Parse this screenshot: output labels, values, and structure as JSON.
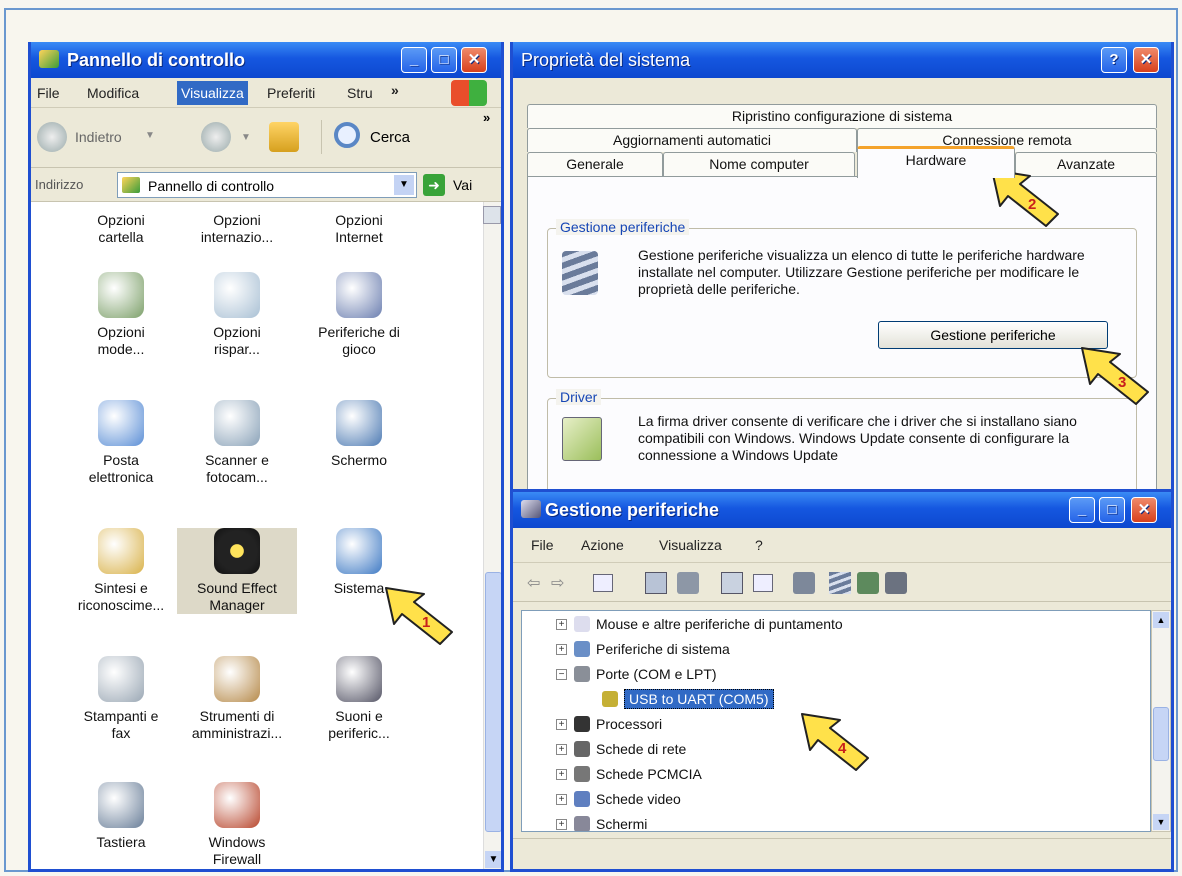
{
  "colors": {
    "title_blue": "#1557e0",
    "close_red": "#d8401c",
    "xp_beige": "#ece9d8",
    "arrow_yellow": "#ffe14a"
  },
  "control_panel": {
    "title": "Pannello di controllo",
    "menu": [
      "File",
      "Modifica",
      "Visualizza",
      "Preferiti",
      "Stru"
    ],
    "menu_more": "»",
    "back_label": "Indietro",
    "search_label": "Cerca",
    "address_label": "Indirizzo",
    "address_value": "Pannello di controllo",
    "go_label": "Vai",
    "icons": [
      {
        "line1": "Opzioni",
        "line2": "cartella",
        "icon": "folder-options-icon"
      },
      {
        "line1": "Opzioni",
        "line2": "internazio...",
        "icon": "regional-options-icon"
      },
      {
        "line1": "Opzioni",
        "line2": "Internet",
        "icon": "internet-options-icon"
      },
      {
        "line1": "Opzioni",
        "line2": "mode...",
        "icon": "modem-icon"
      },
      {
        "line1": "Opzioni",
        "line2": "rispar...",
        "icon": "power-options-icon"
      },
      {
        "line1": "Periferiche di",
        "line2": "gioco",
        "icon": "game-controller-icon"
      },
      {
        "line1": "Posta",
        "line2": "elettronica",
        "icon": "mail-icon"
      },
      {
        "line1": "Scanner e",
        "line2": "fotocam...",
        "icon": "scanner-camera-icon"
      },
      {
        "line1": "Schermo",
        "line2": "",
        "icon": "display-icon"
      },
      {
        "line1": "Sintesi e",
        "line2": "riconoscime...",
        "icon": "speech-icon"
      },
      {
        "line1": "Sound Effect",
        "line2": "Manager",
        "icon": "sound-effect-icon"
      },
      {
        "line1": "Sistema",
        "line2": "",
        "icon": "system-icon"
      },
      {
        "line1": "Stampanti e",
        "line2": "fax",
        "icon": "printer-icon"
      },
      {
        "line1": "Strumenti di",
        "line2": "amministrazi...",
        "icon": "admin-tools-icon"
      },
      {
        "line1": "Suoni e",
        "line2": "periferic...",
        "icon": "sounds-icon"
      },
      {
        "line1": "Tastiera",
        "line2": "",
        "icon": "keyboard-icon"
      },
      {
        "line1": "Windows",
        "line2": "Firewall",
        "icon": "firewall-icon"
      }
    ]
  },
  "system_props": {
    "title": "Proprietà del sistema",
    "help_btn": "?",
    "tabs_row1": [
      "Ripristino configurazione di sistema"
    ],
    "tabs_row2": [
      "Aggiornamenti automatici",
      "Connessione remota"
    ],
    "tabs_row3": [
      "Generale",
      "Nome computer",
      "Hardware",
      "Avanzate"
    ],
    "group1_title": "Gestione periferiche",
    "group1_text": "Gestione periferiche visualizza un elenco di tutte le periferiche hardware installate nel computer. Utilizzare Gestione periferiche per modificare le proprietà delle periferiche.",
    "group1_button": "Gestione periferiche",
    "group2_title": "Driver",
    "group2_text": "La firma driver consente di verificare che i driver che si installano siano compatibili con Windows. Windows Update consente di configurare la connessione a Windows Update"
  },
  "device_manager": {
    "title": "Gestione periferiche",
    "menu": [
      "File",
      "Azione",
      "Visualizza",
      "?"
    ],
    "tree": [
      {
        "label": "Mouse e altre periferiche di puntamento",
        "expander": "+",
        "indent": 0
      },
      {
        "label": "Periferiche di sistema",
        "expander": "+",
        "indent": 0
      },
      {
        "label": "Porte (COM e LPT)",
        "expander": "−",
        "indent": 0
      },
      {
        "label": "USB to UART (COM5)",
        "expander": "",
        "indent": 1,
        "selected": true
      },
      {
        "label": "Processori",
        "expander": "+",
        "indent": 0
      },
      {
        "label": "Schede di rete",
        "expander": "+",
        "indent": 0
      },
      {
        "label": "Schede PCMCIA",
        "expander": "+",
        "indent": 0
      },
      {
        "label": "Schede video",
        "expander": "+",
        "indent": 0
      },
      {
        "label": "Schermi",
        "expander": "+",
        "indent": 0
      }
    ]
  },
  "callouts": [
    "1",
    "2",
    "3",
    "4"
  ]
}
